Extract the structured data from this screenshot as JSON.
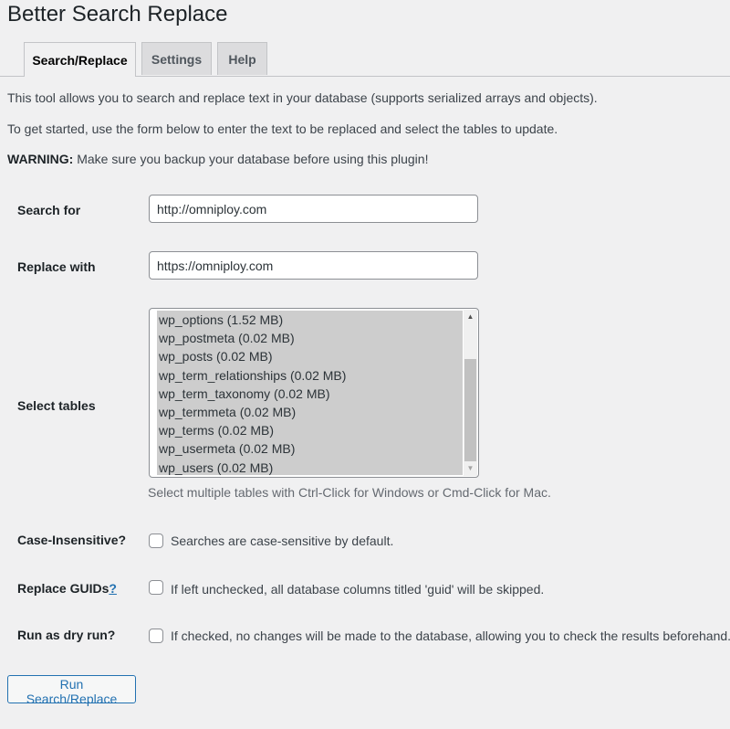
{
  "page": {
    "title": "Better Search Replace"
  },
  "tabs": [
    {
      "label": "Search/Replace",
      "active": true
    },
    {
      "label": "Settings",
      "active": false
    },
    {
      "label": "Help",
      "active": false
    }
  ],
  "intro": {
    "line1": "This tool allows you to search and replace text in your database (supports serialized arrays and objects).",
    "line2": "To get started, use the form below to enter the text to be replaced and select the tables to update.",
    "warning_label": "WARNING:",
    "warning_text": " Make sure you backup your database before using this plugin!"
  },
  "form": {
    "search_label": "Search for",
    "search_value": "http://omniploy.com",
    "replace_label": "Replace with",
    "replace_value": "https://omniploy.com",
    "tables_label": "Select tables",
    "tables": [
      "wp_options (1.52 MB)",
      "wp_postmeta (0.02 MB)",
      "wp_posts (0.02 MB)",
      "wp_term_relationships (0.02 MB)",
      "wp_term_taxonomy (0.02 MB)",
      "wp_termmeta (0.02 MB)",
      "wp_terms (0.02 MB)",
      "wp_usermeta (0.02 MB)",
      "wp_users (0.02 MB)"
    ],
    "tables_hint": "Select multiple tables with Ctrl-Click for Windows or Cmd-Click for Mac.",
    "case_label": "Case-Insensitive?",
    "case_desc": "Searches are case-sensitive by default.",
    "guid_label": "Replace GUIDs",
    "guid_help_link": "?",
    "guid_desc": "If left unchecked, all database columns titled 'guid' will be skipped.",
    "dry_label": "Run as dry run?",
    "dry_desc": "If checked, no changes will be made to the database, allowing you to check the results beforehand.",
    "submit_label": "Run Search/Replace"
  },
  "icons": {
    "scroll_up": "scroll-up-arrow-icon",
    "scroll_down": "scroll-down-arrow-icon"
  },
  "colors": {
    "accent": "#2271b1",
    "selected_bg": "#cdcdcd",
    "page_bg": "#f0f0f1"
  }
}
